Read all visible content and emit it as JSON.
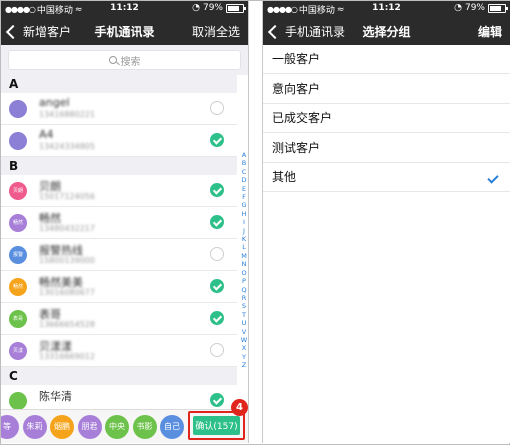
{
  "left_screen": {
    "status": {
      "carrier": "中国移动",
      "time": "11:12",
      "battery": "79%"
    },
    "nav": {
      "back_label": "新增客户",
      "title": "手机通讯录",
      "right_action": "取消全选"
    },
    "search": {
      "placeholder": "搜索"
    },
    "sections": [
      {
        "letter": "A",
        "contacts": [
          {
            "name": "angel",
            "phone": "13416880221",
            "avatar_label": "",
            "avatar_color": "#8b7fd6",
            "checked": false,
            "name_blurred": true
          },
          {
            "name": "A4",
            "phone": "13424334805",
            "avatar_label": "",
            "avatar_color": "#8b7fd6",
            "checked": true,
            "name_blurred": true
          }
        ]
      },
      {
        "letter": "B",
        "contacts": [
          {
            "name": "贝朗",
            "phone": "15017124056",
            "avatar_label": "贝朗",
            "avatar_color": "#ef5b8c",
            "checked": true,
            "name_blurred": true
          },
          {
            "name": "畅然",
            "phone": "13480432217",
            "avatar_label": "畅然",
            "avatar_color": "#a77fd8",
            "checked": true,
            "name_blurred": true
          },
          {
            "name": "报警热线",
            "phone": "15800139000",
            "avatar_label": "报警",
            "avatar_color": "#5a8fe0",
            "checked": false,
            "name_blurred": true
          },
          {
            "name": "畅然美美",
            "phone": "13016080677",
            "avatar_label": "畅然",
            "avatar_color": "#f5a31a",
            "checked": true,
            "name_blurred": true
          },
          {
            "name": "表哥",
            "phone": "13666654528",
            "avatar_label": "表哥",
            "avatar_color": "#6cc24a",
            "checked": true,
            "name_blurred": true
          },
          {
            "name": "贝漾漾",
            "phone": "13316669012",
            "avatar_label": "贝漾",
            "avatar_color": "#a77fd8",
            "checked": false,
            "name_blurred": true
          }
        ]
      },
      {
        "letter": "C",
        "contacts": [
          {
            "name": "陈华清",
            "phone": "",
            "avatar_label": "",
            "avatar_color": "#6cc24a",
            "checked": true,
            "name_blurred": false
          }
        ]
      }
    ],
    "index_letters": [
      "A",
      "B",
      "C",
      "D",
      "E",
      "F",
      "G",
      "H",
      "I",
      "J",
      "K",
      "L",
      "M",
      "N",
      "O",
      "P",
      "Q",
      "R",
      "S",
      "T",
      "U",
      "V",
      "W",
      "X",
      "Y",
      "Z"
    ],
    "selected_chips": [
      {
        "label": "等",
        "color": "#a77fd8"
      },
      {
        "label": "朱莉",
        "color": "#a77fd8"
      },
      {
        "label": "烟鹏",
        "color": "#f5a31a"
      },
      {
        "label": "朋君",
        "color": "#a77fd8"
      },
      {
        "label": "中央",
        "color": "#6cc24a"
      },
      {
        "label": "书影",
        "color": "#6cc24a"
      },
      {
        "label": "自己",
        "color": "#5a8fe0"
      }
    ],
    "confirm_label": "确认(157)",
    "step_badge": "4"
  },
  "right_screen": {
    "status": {
      "carrier": "中国移动",
      "time": "11:12",
      "battery": "79%"
    },
    "nav": {
      "back_label": "手机通讯录",
      "title": "选择分组",
      "right_action": "编辑"
    },
    "groups": [
      {
        "label": "一般客户",
        "selected": false
      },
      {
        "label": "意向客户",
        "selected": false
      },
      {
        "label": "已成交客户",
        "selected": false
      },
      {
        "label": "测试客户",
        "selected": false
      },
      {
        "label": "其他",
        "selected": true
      }
    ]
  },
  "colors": {
    "nav_bg": "#2b2b2b",
    "accent_green": "#2ec08a",
    "accent_blue": "#2a80d8",
    "highlight_red": "#e0251d"
  }
}
